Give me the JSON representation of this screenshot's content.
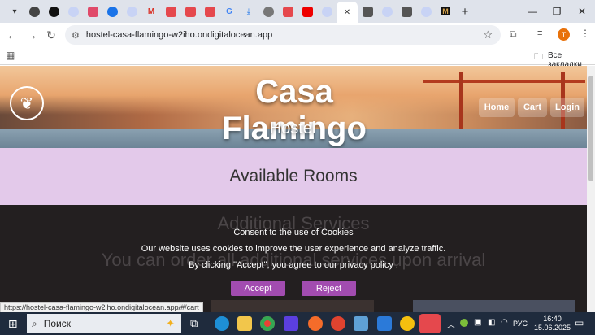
{
  "browser": {
    "tabs": [
      {
        "icon": "chevron-down-icon"
      },
      {
        "icon": "site-icon"
      },
      {
        "icon": "site-icon"
      },
      {
        "icon": "site-icon"
      },
      {
        "icon": "site-icon"
      },
      {
        "icon": "site-icon"
      },
      {
        "icon": "gmail-icon",
        "text": "M"
      },
      {
        "icon": "site-icon"
      },
      {
        "icon": "site-icon"
      },
      {
        "icon": "site-icon"
      },
      {
        "icon": "google-icon",
        "text": "G"
      },
      {
        "icon": "download-icon"
      },
      {
        "icon": "site-icon"
      },
      {
        "icon": "site-icon"
      },
      {
        "icon": "youtube-icon"
      },
      {
        "icon": "site-icon"
      },
      {
        "icon": "close-icon",
        "text": "✕",
        "active": true
      },
      {
        "icon": "site-icon"
      },
      {
        "icon": "site-icon"
      },
      {
        "icon": "site-icon"
      },
      {
        "icon": "site-icon"
      },
      {
        "icon": "site-icon",
        "text": "M"
      },
      {
        "icon": "site-icon"
      }
    ],
    "new_tab_label": "+",
    "url": "hostel-casa-flamingo-w2iho.ondigitalocean.app",
    "profile_initial": "T",
    "bookmarks_label": "Все закладки",
    "status_url": "https://hostel-casa-flamingo-w2iho.ondigitalocean.app/#/cart"
  },
  "site": {
    "title": "Casa Flamingo",
    "subtitle": "Hostel",
    "nav": [
      "Home",
      "Cart",
      "Login"
    ],
    "section_title": "Available Rooms",
    "services_title": "Additional Services",
    "services_text": "You can order all additional services upon arrival"
  },
  "cookie": {
    "title": "Consent to the use of Cookies",
    "line1": "Our website uses cookies to improve the user experience and analyze traffic.",
    "line2": "By clicking \"Accept\", you agree to our privacy policy .",
    "accept": "Accept",
    "reject": "Reject"
  },
  "taskbar": {
    "search_placeholder": "Поиск",
    "lang": "РУС",
    "time": "16:40",
    "date": "15.06.2025"
  },
  "colors": {
    "accent_purple": "#a24cb0",
    "band_lilac": "#e3c9ea",
    "dark_bg": "#231f20"
  }
}
